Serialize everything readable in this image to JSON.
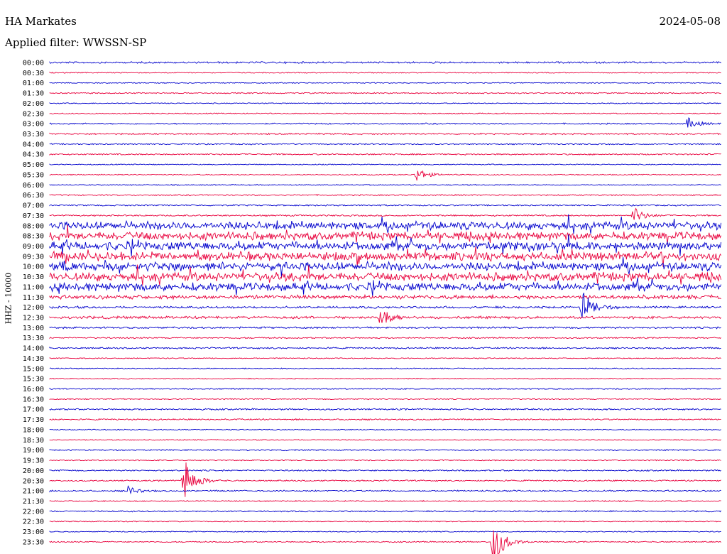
{
  "header": {
    "station": "HA Markates",
    "date": "2024-05-08",
    "filter_label": "Applied filter: WWSSN-SP"
  },
  "channel_label": "HHZ - 10000",
  "colors": {
    "trace_a": "#0000cc",
    "trace_b": "#e8003c"
  },
  "chart_data": {
    "type": "helicorder",
    "title": "HA Markates",
    "subtitle": "Applied filter: WWSSN-SP",
    "ylabel": "HHZ - 10000",
    "row_interval_minutes": 30,
    "tick_labels": [
      "00:00",
      "00:30",
      "01:00",
      "01:30",
      "02:00",
      "02:30",
      "03:00",
      "03:30",
      "04:00",
      "04:30",
      "05:00",
      "05:30",
      "06:00",
      "06:30",
      "07:00",
      "07:30",
      "08:00",
      "08:30",
      "09:00",
      "09:30",
      "10:00",
      "10:30",
      "11:00",
      "11:30",
      "12:00",
      "12:30",
      "13:00",
      "13:30",
      "14:00",
      "14:30",
      "15:00",
      "15:30",
      "16:00",
      "16:30",
      "17:00",
      "17:30",
      "18:00",
      "18:30",
      "19:00",
      "19:30",
      "20:00",
      "20:30",
      "21:00",
      "21:30",
      "22:00",
      "22:30",
      "23:00",
      "23:30"
    ],
    "row_colors": [
      "blue",
      "red"
    ],
    "activity_level": [
      0.15,
      0.05,
      0.05,
      0.08,
      0.05,
      0.06,
      0.1,
      0.12,
      0.08,
      0.1,
      0.05,
      0.06,
      0.06,
      0.08,
      0.1,
      0.12,
      0.9,
      0.9,
      0.95,
      0.95,
      0.95,
      0.95,
      0.9,
      0.4,
      0.2,
      0.25,
      0.15,
      0.1,
      0.12,
      0.06,
      0.06,
      0.06,
      0.08,
      0.06,
      0.12,
      0.1,
      0.05,
      0.05,
      0.08,
      0.06,
      0.1,
      0.1,
      0.12,
      0.08,
      0.1,
      0.06,
      0.05,
      0.08
    ],
    "events": [
      {
        "row": 6,
        "minute": 28.5,
        "amplitude": 8
      },
      {
        "row": 11,
        "minute": 16.4,
        "amplitude": 10
      },
      {
        "row": 15,
        "minute": 26.1,
        "amplitude": 12
      },
      {
        "row": 24,
        "minute": 23.8,
        "amplitude": 24
      },
      {
        "row": 25,
        "minute": 14.8,
        "amplitude": 16
      },
      {
        "row": 41,
        "minute": 6.0,
        "amplitude": 34
      },
      {
        "row": 42,
        "minute": 3.5,
        "amplitude": 6
      },
      {
        "row": 47,
        "minute": 19.8,
        "amplitude": 38
      }
    ]
  }
}
